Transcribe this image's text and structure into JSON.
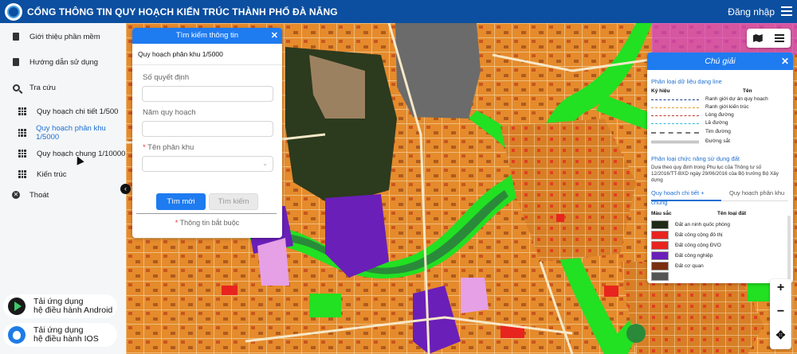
{
  "header": {
    "title": "CỔNG THÔNG TIN QUY HOẠCH KIẾN TRÚC THÀNH PHỐ ĐÀ NẴNG",
    "login": "Đăng nhập"
  },
  "sidebar": {
    "items": [
      {
        "label": "Giới thiệu phần mềm",
        "icon": "document-icon"
      },
      {
        "label": "Hướng dẫn sử dụng",
        "icon": "document-icon"
      },
      {
        "label": "Tra cứu",
        "icon": "search-icon"
      },
      {
        "label": "Quy hoạch chi tiết 1/500",
        "icon": "grid-icon"
      },
      {
        "label": "Quy hoạch phân khu 1/5000",
        "icon": "grid-icon",
        "active": true
      },
      {
        "label": "Quy hoạch chung 1/10000",
        "icon": "grid-icon"
      },
      {
        "label": "Kiến trúc",
        "icon": "grid-icon"
      },
      {
        "label": "Thoát",
        "icon": "close-circle-icon"
      }
    ],
    "apps": [
      {
        "line1": "Tải ứng dụng",
        "line2": "hệ điều hành Android"
      },
      {
        "line1": "Tải ứng dụng",
        "line2": "hệ điều hành IOS"
      }
    ]
  },
  "search_panel": {
    "title": "Tìm kiếm thông tin",
    "subtitle": "Quy hoạch phân khu 1/5000",
    "fields": [
      {
        "label": "Số quyết định",
        "value": ""
      },
      {
        "label": "Năm quy hoạch",
        "value": ""
      },
      {
        "label": "Tên phân khu",
        "required": true,
        "value": ""
      }
    ],
    "required_mark": "*",
    "btn_new": "Tìm mới",
    "btn_search": "Tìm kiếm",
    "note": "Thông tin bắt buộc"
  },
  "legend": {
    "title": "Chú giải",
    "line_section": "Phân loại dữ liệu dạng line",
    "col_symbol": "Ký hiệu",
    "col_name": "Tên",
    "lines": [
      {
        "name": "Ranh giới dự án quy hoạch",
        "color": "#1a3e8c",
        "style": "dashed"
      },
      {
        "name": "Ranh giới kiến trúc",
        "color": "#e09a2b",
        "style": "dashed"
      },
      {
        "name": "Lòng đường",
        "color": "#c0392b",
        "style": "dashed"
      },
      {
        "name": "Lề đường",
        "color": "#2bb8d9",
        "style": "dashed"
      },
      {
        "name": "Tim đường",
        "color": "#777777",
        "style": "dashdot"
      },
      {
        "name": "Đường sắt",
        "color": "#999999",
        "style": "rail"
      }
    ],
    "land_section": "Phân loại chức năng sử dụng đất",
    "land_note": "Dựa theo quy định trong Phụ lục của Thông tư số 12/2016/TT-BXD ngày 29/06/2016 của Bộ trưởng Bộ Xây dựng",
    "tabs": [
      "Quy hoạch chi tiết + chung",
      "Quy hoạch phân khu"
    ],
    "col_color": "Màu sắc",
    "col_type": "Tên loại đất",
    "land_types": [
      {
        "name": "Đất an ninh quốc phòng",
        "color": "#1f2a17"
      },
      {
        "name": "Đất công cộng đô thị",
        "color": "#e8241f"
      },
      {
        "name": "Đất công cộng ĐVO",
        "color": "#e8241f"
      },
      {
        "name": "Đất công nghiệp",
        "color": "#6a1fb8"
      },
      {
        "name": "Đất cơ quan",
        "color": "#7a2d10"
      }
    ]
  },
  "colors": {
    "header": "#0c4fa0",
    "accent": "#1f7bf0",
    "residential": "#e58b2c",
    "green": "#22e022",
    "water": "#2a8a3a"
  }
}
